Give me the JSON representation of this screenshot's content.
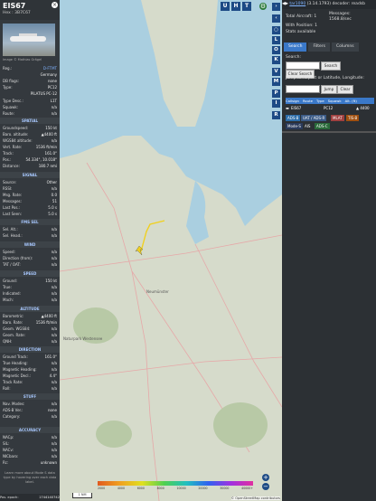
{
  "aircraft": {
    "registration": "EIS67",
    "hex_label": "Hex : 3B7C67",
    "photo_caption": "Image © Mathias Grägel"
  },
  "details": {
    "reg": {
      "label": "Reg.:",
      "value": "D-FTMT"
    },
    "country": {
      "label": "",
      "value": "Germany"
    },
    "db_flags": {
      "label": "DB flags:",
      "value": "none"
    },
    "type": {
      "label": "Type:",
      "value": "PC12"
    },
    "model": {
      "label": "",
      "value": "PILATUS PC-12"
    },
    "type_desc": {
      "label": "Type Desc.:",
      "value": "L1T"
    },
    "squawk": {
      "label": "Squawk:",
      "value": "n/a"
    },
    "route": {
      "label": "Route:",
      "value": "n/a"
    }
  },
  "sections": {
    "spatial": "SPATIAL",
    "signal": "SIGNAL",
    "fms_sel": "FMS SEL",
    "wind": "WIND",
    "speed": "SPEED",
    "altitude": "ALTITUDE",
    "direction": "DIRECTION",
    "stuff": "STUFF",
    "accuracy": "ACCURACY"
  },
  "spatial": [
    {
      "label": "Groundspeed:",
      "value": "150 kt"
    },
    {
      "label": "Baro. altitude:",
      "value": "▲4400 ft"
    },
    {
      "label": "WGS84 altitude:",
      "value": "n/a"
    },
    {
      "label": "Vert. Rate:",
      "value": "1536 ft/min"
    },
    {
      "label": "Track:",
      "value": "161.0°"
    },
    {
      "label": "Pos.:",
      "value": "54.334°, 10.018°"
    },
    {
      "label": "Distance:",
      "value": "180.7 nmi"
    }
  ],
  "signal": [
    {
      "label": "Source:",
      "value": "Other"
    },
    {
      "label": "RSSI:",
      "value": "n/a"
    },
    {
      "label": "Msg. Rate:",
      "value": "0.0"
    },
    {
      "label": "Messages:",
      "value": "51"
    },
    {
      "label": "Last Pos.:",
      "value": "5.0 s"
    },
    {
      "label": "Last Seen:",
      "value": "5.0 s"
    }
  ],
  "fms": [
    {
      "label": "Sel. Alt.:",
      "value": "n/a"
    },
    {
      "label": "Sel. Head.:",
      "value": "n/a"
    }
  ],
  "wind": [
    {
      "label": "Speed:",
      "value": "n/a"
    },
    {
      "label": "Direction (from):",
      "value": "n/a"
    },
    {
      "label": "TAT / OAT:",
      "value": "n/a"
    }
  ],
  "speed": [
    {
      "label": "Ground:",
      "value": "150 kt"
    },
    {
      "label": "True:",
      "value": "n/a"
    },
    {
      "label": "Indicated:",
      "value": "n/a"
    },
    {
      "label": "Mach:",
      "value": "n/a"
    }
  ],
  "altitude": [
    {
      "label": "Barometric:",
      "value": "▲4400 ft"
    },
    {
      "label": "Baro. Rate:",
      "value": "1536 ft/min"
    },
    {
      "label": "Geom. WGS84:",
      "value": "n/a"
    },
    {
      "label": "Geom. Rate:",
      "value": "n/a"
    },
    {
      "label": "QNH:",
      "value": "n/a"
    }
  ],
  "direction": [
    {
      "label": "Ground Track:",
      "value": "161.0°"
    },
    {
      "label": "True Heading:",
      "value": "n/a"
    },
    {
      "label": "Magnetic Heading:",
      "value": "n/a"
    },
    {
      "label": "Magnetic Decl.:",
      "value": "4.4°"
    },
    {
      "label": "Track Rate:",
      "value": "n/a"
    },
    {
      "label": "Roll:",
      "value": "n/a"
    }
  ],
  "stuff": [
    {
      "label": "Nav. Modes:",
      "value": "n/a"
    },
    {
      "label": "ADS-B Ver.:",
      "value": "none"
    },
    {
      "label": "Category:",
      "value": "n/a"
    }
  ],
  "accuracy": [
    {
      "label": "NACp:",
      "value": "n/a"
    },
    {
      "label": "SIL:",
      "value": "n/a"
    },
    {
      "label": "NACv:",
      "value": "n/a"
    },
    {
      "label": "NICbaro:",
      "value": "n/a"
    },
    {
      "label": "Rc:",
      "value": "unknown"
    }
  ],
  "footer_note": "Learn more about Mode S data type by hovering over each data label.",
  "pos_epoch": {
    "label": "Pos. epoch:",
    "value": "1744140742"
  },
  "map": {
    "top_buttons": [
      "U",
      "H",
      "T"
    ],
    "side_buttons": [
      "L",
      "O",
      "K",
      "V",
      "M",
      "P",
      "I",
      "R"
    ],
    "zoom_in": "+",
    "zoom_out": "−",
    "scale": "1 NM",
    "alt_labels": [
      "2000",
      "4000",
      "6000",
      "8000",
      "10000",
      "20000",
      "30000",
      "40000+"
    ],
    "attribution": "© OpenStreetMap contributors",
    "place_labels": [
      "Neumünster",
      "Naturpark Westensee"
    ]
  },
  "right_panel": {
    "link": "tar1090",
    "version": "(3.14.1793) decoder: readsb",
    "total_label": "Total Aircraft: 1",
    "messages_label": "Messages:",
    "messages_value": "1568.8/sec",
    "with_position": "With Position: 1",
    "stats": "Stats available",
    "tabs": [
      "Search",
      "Filters",
      "Columns"
    ],
    "search_label": "Search:",
    "search_button": "Search",
    "clear_search": "Clear Search",
    "jump_label": "Jump to Airport or Latitude, Longitude:",
    "jump_button": "Jump",
    "clear_button": "Clear",
    "columns": [
      "Callsign",
      "Route",
      "Type",
      "Squawk",
      "Alt. (ft)"
    ],
    "row": {
      "callsign": "EIS67",
      "type": "PC12",
      "alt": "▲ 4400"
    },
    "badges": [
      "ADS-B",
      "UAT / ADS-R",
      "MLAT",
      "TIS-B",
      "Mode-S",
      "AIS",
      "ADS-C"
    ]
  }
}
